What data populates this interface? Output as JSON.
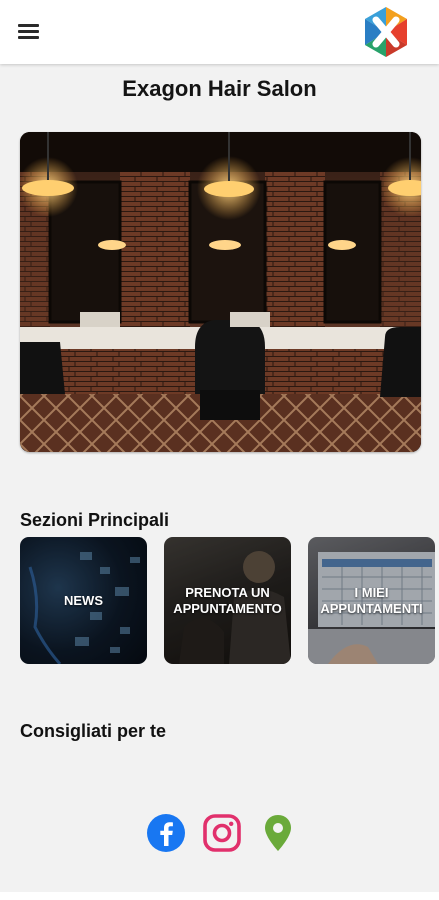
{
  "header": {
    "menu_icon": "hamburger-menu-icon",
    "logo_icon": "exagon-hexagon-x-logo"
  },
  "page": {
    "title": "Exagon Hair Salon"
  },
  "hero": {
    "image": "barbershop-interior-photo"
  },
  "sections": {
    "title": "Sezioni Principali",
    "cards": [
      {
        "label": "NEWS",
        "image": "digital-network-background"
      },
      {
        "label": "PRENOTA UN APPUNTAMENTO",
        "line1": "PRENOTA UN",
        "line2": "APPUNTAMENTO",
        "image": "barber-cutting-hair-photo"
      },
      {
        "label": "I MIEI APPUNTAMENTI",
        "line1": "I MIEI",
        "line2": "APPUNTAMENTI",
        "image": "laptop-calendar-photo"
      }
    ]
  },
  "recommended": {
    "title": "Consigliati per te"
  },
  "social": {
    "icons": [
      "facebook-icon",
      "instagram-icon",
      "map-pin-icon"
    ]
  },
  "colors": {
    "background": "#f2f2f2",
    "appbar": "#ffffff",
    "facebook": "#1877f2",
    "instagram": "#e1306c",
    "map_pin": "#6aaa3a"
  }
}
